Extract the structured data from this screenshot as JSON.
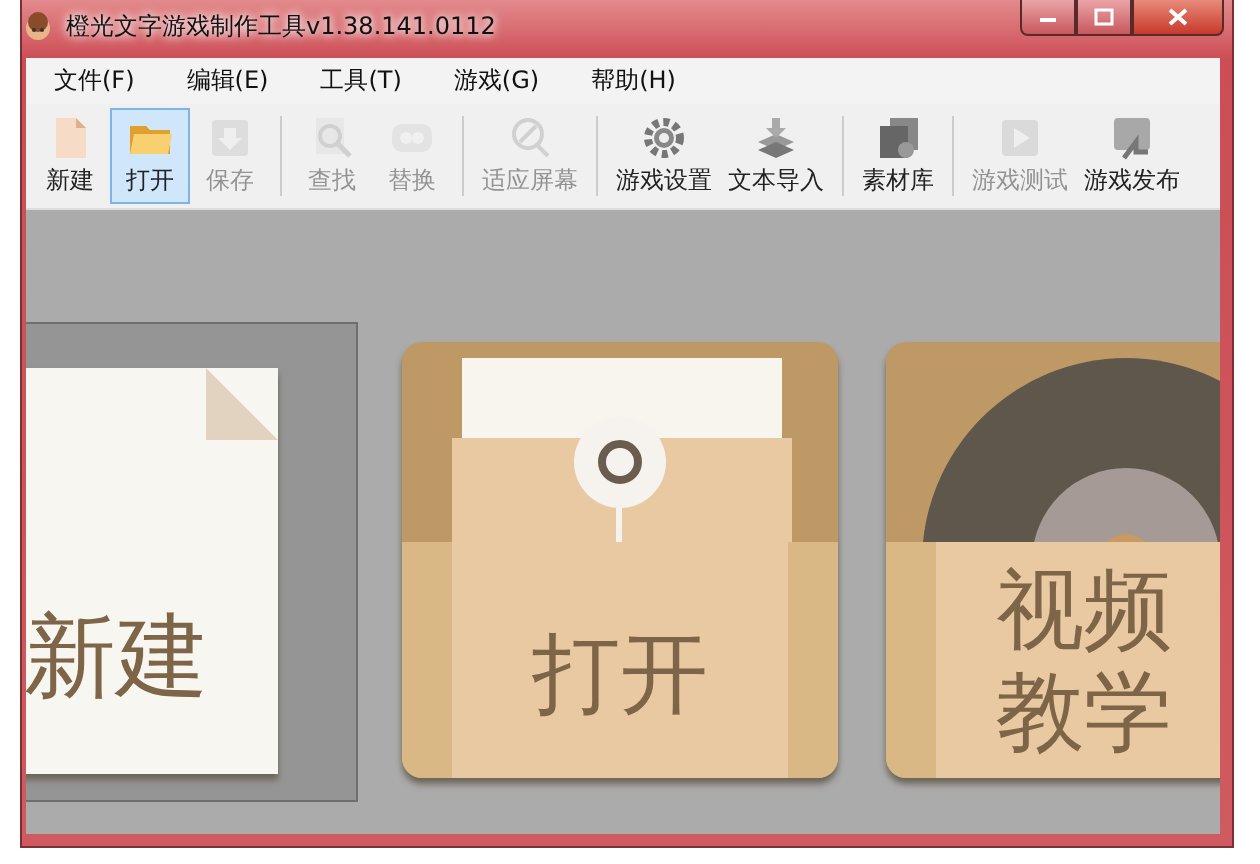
{
  "window": {
    "title": "橙光文字游戏制作工具v1.38.141.0112"
  },
  "menu": [
    {
      "label": "文件(F)"
    },
    {
      "label": "编辑(E)"
    },
    {
      "label": "工具(T)"
    },
    {
      "label": "游戏(G)"
    },
    {
      "label": "帮助(H)"
    }
  ],
  "toolbar": [
    [
      {
        "label": "新建",
        "kind": "new",
        "selected": false,
        "disabled": false
      },
      {
        "label": "打开",
        "kind": "open",
        "selected": true,
        "disabled": false
      },
      {
        "label": "保存",
        "kind": "save",
        "selected": false,
        "disabled": true
      }
    ],
    [
      {
        "label": "查找",
        "kind": "find",
        "selected": false,
        "disabled": true
      },
      {
        "label": "替换",
        "kind": "replace",
        "selected": false,
        "disabled": true
      }
    ],
    [
      {
        "label": "适应屏幕",
        "kind": "fit",
        "selected": false,
        "disabled": true
      }
    ],
    [
      {
        "label": "游戏设置",
        "kind": "settings",
        "selected": false,
        "disabled": false
      },
      {
        "label": "文本导入",
        "kind": "import",
        "selected": false,
        "disabled": false
      }
    ],
    [
      {
        "label": "素材库",
        "kind": "library",
        "selected": false,
        "disabled": false
      }
    ],
    [
      {
        "label": "游戏测试",
        "kind": "test",
        "selected": false,
        "disabled": true
      },
      {
        "label": "游戏发布",
        "kind": "publish",
        "selected": false,
        "disabled": false
      }
    ]
  ],
  "cards": [
    {
      "kind": "new",
      "lines": [
        "新建"
      ],
      "selected": true
    },
    {
      "kind": "open",
      "lines": [
        "打开"
      ],
      "selected": false
    },
    {
      "kind": "video",
      "lines": [
        "视频",
        "教学"
      ],
      "selected": false
    }
  ]
}
